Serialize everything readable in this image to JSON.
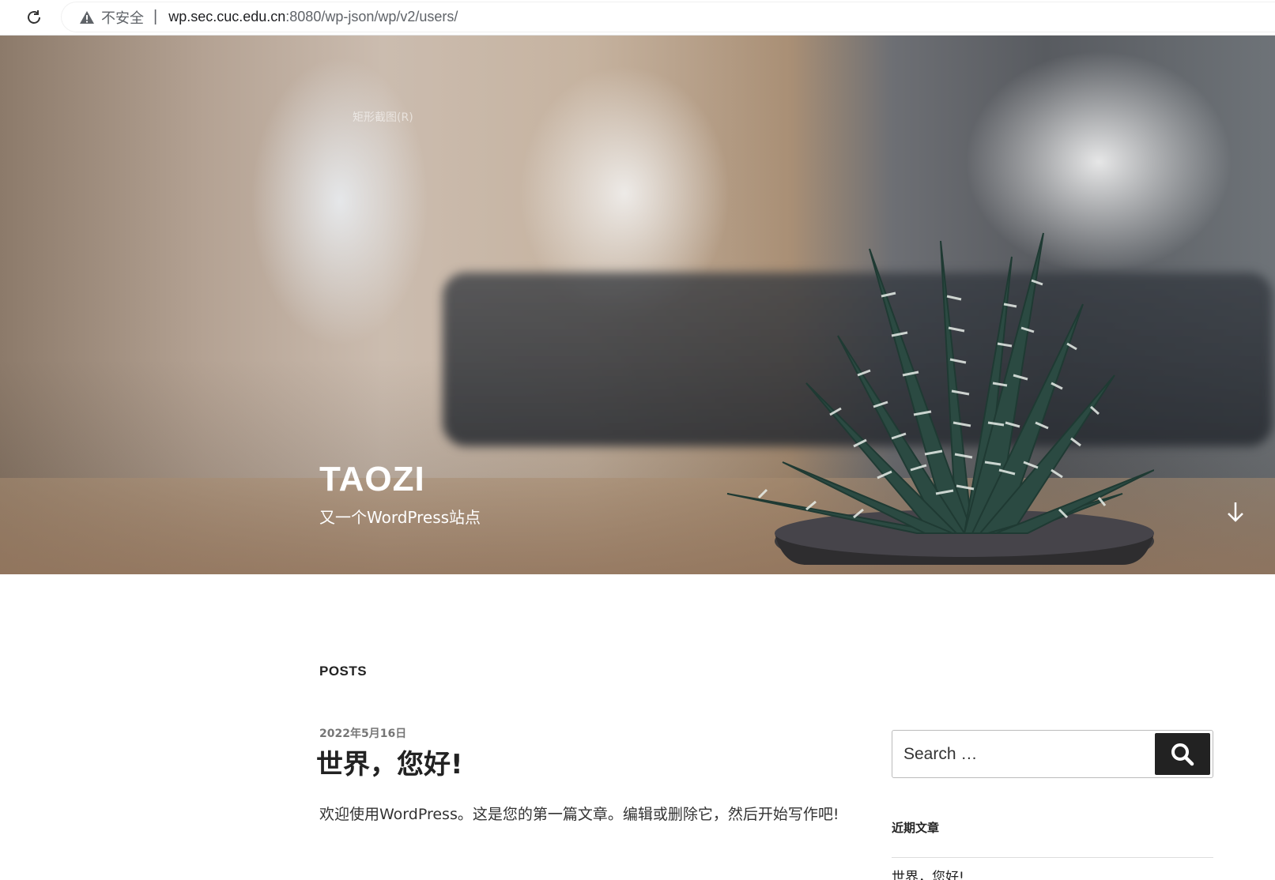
{
  "browser": {
    "security_label": "不安全",
    "separator": "|",
    "url_host": "wp.sec.cuc.edu.cn",
    "url_rest": ":8080/wp-json/wp/v2/users/"
  },
  "hero": {
    "overlay_tip": "矩形截图(R)",
    "site_title": "TAOZI",
    "site_description": "又一个WordPress站点"
  },
  "main": {
    "section_label": "POSTS",
    "post": {
      "date": "2022年5月16日",
      "title": "世界，您好!",
      "excerpt": "欢迎使用WordPress。这是您的第一篇文章。编辑或删除它，然后开始写作吧!"
    }
  },
  "sidebar": {
    "search_placeholder": "Search …",
    "recent_heading": "近期文章",
    "recent_items": [
      "世界，您好!"
    ]
  },
  "icons": {
    "reload": "reload-icon",
    "warning": "warning-icon",
    "scroll": "arrow-down-icon",
    "search": "search-icon"
  },
  "colors": {
    "button_bg": "#222222",
    "text": "#222222",
    "date": "#767676"
  }
}
